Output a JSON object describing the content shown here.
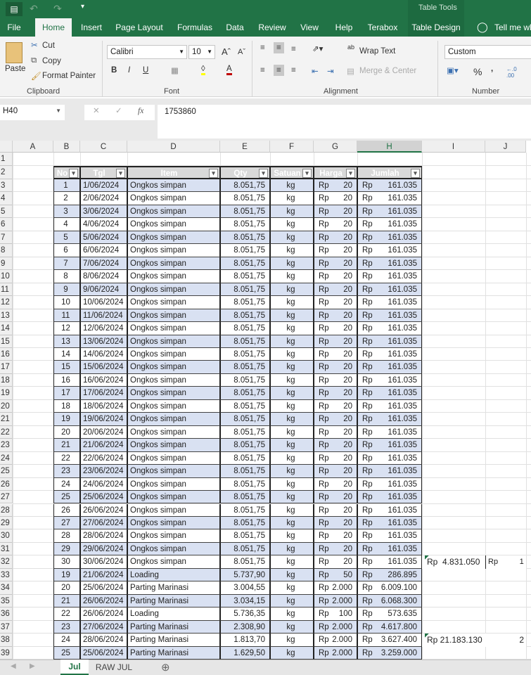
{
  "qat": {
    "save": "save-icon",
    "undo": "undo-icon",
    "redo": "redo-icon"
  },
  "tabs": [
    "File",
    "Home",
    "Insert",
    "Page Layout",
    "Formulas",
    "Data",
    "Review",
    "View",
    "Help",
    "Terabox",
    "Table Design"
  ],
  "table_tools": "Table Tools",
  "tell_me": "Tell me wh",
  "clipboard": {
    "paste": "Paste",
    "cut": "Cut",
    "copy": "Copy",
    "format_painter": "Format Painter",
    "group": "Clipboard"
  },
  "font": {
    "name": "Calibri",
    "size": "10",
    "bold": "B",
    "italic": "I",
    "underline": "U",
    "group": "Font",
    "fill_color": "#ffff00",
    "font_color": "#c00000"
  },
  "alignment": {
    "wrap": "Wrap Text",
    "merge": "Merge & Center",
    "group": "Alignment"
  },
  "number": {
    "format": "Custom",
    "percent": "%",
    "comma": ",",
    "group": "Number"
  },
  "name_box": "H40",
  "formula": "1753860",
  "columns": [
    "A",
    "B",
    "C",
    "D",
    "E",
    "F",
    "G",
    "H",
    "I",
    "J"
  ],
  "table_headers": [
    "No",
    "Tgl",
    "Item",
    "Qty",
    "Satuan",
    "Harga",
    "Jumlah"
  ],
  "rows": [
    [
      "1",
      "1/06/2024",
      "Ongkos simpan",
      "8.051,75",
      "kg",
      "20",
      "161.035"
    ],
    [
      "2",
      "2/06/2024",
      "Ongkos simpan",
      "8.051,75",
      "kg",
      "20",
      "161.035"
    ],
    [
      "3",
      "3/06/2024",
      "Ongkos simpan",
      "8.051,75",
      "kg",
      "20",
      "161.035"
    ],
    [
      "4",
      "4/06/2024",
      "Ongkos simpan",
      "8.051,75",
      "kg",
      "20",
      "161.035"
    ],
    [
      "5",
      "5/06/2024",
      "Ongkos simpan",
      "8.051,75",
      "kg",
      "20",
      "161.035"
    ],
    [
      "6",
      "6/06/2024",
      "Ongkos simpan",
      "8.051,75",
      "kg",
      "20",
      "161.035"
    ],
    [
      "7",
      "7/06/2024",
      "Ongkos simpan",
      "8.051,75",
      "kg",
      "20",
      "161.035"
    ],
    [
      "8",
      "8/06/2024",
      "Ongkos simpan",
      "8.051,75",
      "kg",
      "20",
      "161.035"
    ],
    [
      "9",
      "9/06/2024",
      "Ongkos simpan",
      "8.051,75",
      "kg",
      "20",
      "161.035"
    ],
    [
      "10",
      "10/06/2024",
      "Ongkos simpan",
      "8.051,75",
      "kg",
      "20",
      "161.035"
    ],
    [
      "11",
      "11/06/2024",
      "Ongkos simpan",
      "8.051,75",
      "kg",
      "20",
      "161.035"
    ],
    [
      "12",
      "12/06/2024",
      "Ongkos simpan",
      "8.051,75",
      "kg",
      "20",
      "161.035"
    ],
    [
      "13",
      "13/06/2024",
      "Ongkos simpan",
      "8.051,75",
      "kg",
      "20",
      "161.035"
    ],
    [
      "14",
      "14/06/2024",
      "Ongkos simpan",
      "8.051,75",
      "kg",
      "20",
      "161.035"
    ],
    [
      "15",
      "15/06/2024",
      "Ongkos simpan",
      "8.051,75",
      "kg",
      "20",
      "161.035"
    ],
    [
      "16",
      "16/06/2024",
      "Ongkos simpan",
      "8.051,75",
      "kg",
      "20",
      "161.035"
    ],
    [
      "17",
      "17/06/2024",
      "Ongkos simpan",
      "8.051,75",
      "kg",
      "20",
      "161.035"
    ],
    [
      "18",
      "18/06/2024",
      "Ongkos simpan",
      "8.051,75",
      "kg",
      "20",
      "161.035"
    ],
    [
      "19",
      "19/06/2024",
      "Ongkos simpan",
      "8.051,75",
      "kg",
      "20",
      "161.035"
    ],
    [
      "20",
      "20/06/2024",
      "Ongkos simpan",
      "8.051,75",
      "kg",
      "20",
      "161.035"
    ],
    [
      "21",
      "21/06/2024",
      "Ongkos simpan",
      "8.051,75",
      "kg",
      "20",
      "161.035"
    ],
    [
      "22",
      "22/06/2024",
      "Ongkos simpan",
      "8.051,75",
      "kg",
      "20",
      "161.035"
    ],
    [
      "23",
      "23/06/2024",
      "Ongkos simpan",
      "8.051,75",
      "kg",
      "20",
      "161.035"
    ],
    [
      "24",
      "24/06/2024",
      "Ongkos simpan",
      "8.051,75",
      "kg",
      "20",
      "161.035"
    ],
    [
      "25",
      "25/06/2024",
      "Ongkos simpan",
      "8.051,75",
      "kg",
      "20",
      "161.035"
    ],
    [
      "26",
      "26/06/2024",
      "Ongkos simpan",
      "8.051,75",
      "kg",
      "20",
      "161.035"
    ],
    [
      "27",
      "27/06/2024",
      "Ongkos simpan",
      "8.051,75",
      "kg",
      "20",
      "161.035"
    ],
    [
      "28",
      "28/06/2024",
      "Ongkos simpan",
      "8.051,75",
      "kg",
      "20",
      "161.035"
    ],
    [
      "29",
      "29/06/2024",
      "Ongkos simpan",
      "8.051,75",
      "kg",
      "20",
      "161.035"
    ],
    [
      "30",
      "30/06/2024",
      "Ongkos simpan",
      "8.051,75",
      "kg",
      "20",
      "161.035"
    ],
    [
      "19",
      "21/06/2024",
      "Loading",
      "5.737,90",
      "kg",
      "50",
      "286.895"
    ],
    [
      "20",
      "25/06/2024",
      "Parting Marinasi",
      "3.004,55",
      "kg",
      "2.000",
      "6.009.100"
    ],
    [
      "21",
      "26/06/2024",
      "Parting Marinasi",
      "3.034,15",
      "kg",
      "2.000",
      "6.068.300"
    ],
    [
      "22",
      "26/06/2024",
      "Loading",
      "5.736,35",
      "kg",
      "100",
      "573.635"
    ],
    [
      "23",
      "27/06/2024",
      "Parting Marinasi",
      "2.308,90",
      "kg",
      "2.000",
      "4.617.800"
    ],
    [
      "24",
      "28/06/2024",
      "Parting Marinasi",
      "1.813,70",
      "kg",
      "2.000",
      "3.627.400"
    ],
    [
      "25",
      "25/06/2024",
      "Parting Marinasi",
      "1.629,50",
      "kg",
      "2.000",
      "3.259.000"
    ]
  ],
  "currency": "Rp",
  "extra": [
    {
      "row": 32,
      "col": "I",
      "text": "Rp  4.831.050"
    },
    {
      "row": 32,
      "col": "J",
      "text": "Rp          1"
    },
    {
      "row": 38,
      "col": "I",
      "text": "Rp 21.183.130"
    },
    {
      "row": 38,
      "col": "J",
      "text": "2"
    }
  ],
  "sheets": [
    "Jul",
    "RAW JUL"
  ],
  "band_color": "#d9e1f2",
  "header_color": "#d9d9d9"
}
